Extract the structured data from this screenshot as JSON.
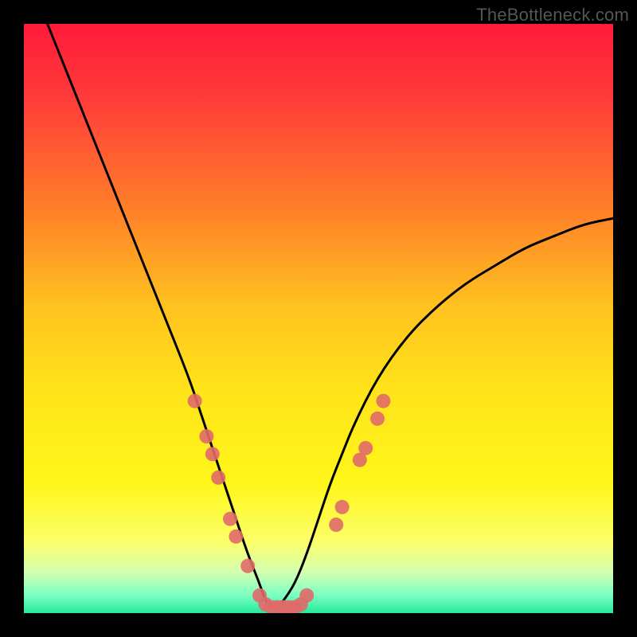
{
  "watermark": "TheBottleneck.com",
  "chart_data": {
    "type": "line",
    "title": "",
    "xlabel": "",
    "ylabel": "",
    "xlim": [
      0,
      100
    ],
    "ylim": [
      0,
      100
    ],
    "series": [
      {
        "name": "bottleneck-curve",
        "x": [
          4,
          8,
          12,
          16,
          20,
          24,
          28,
          30,
          32,
          34,
          36,
          38,
          40,
          41,
          42,
          43,
          44,
          46,
          48,
          50,
          52,
          54,
          56,
          60,
          65,
          70,
          75,
          80,
          85,
          90,
          95,
          100
        ],
        "y": [
          100,
          90,
          80,
          70,
          60,
          50,
          40,
          34,
          28,
          22,
          16,
          10,
          5,
          2,
          1,
          1,
          2,
          5,
          10,
          16,
          22,
          27,
          32,
          40,
          47,
          52,
          56,
          59,
          62,
          64,
          66,
          67
        ]
      }
    ],
    "markers": [
      {
        "x": 29,
        "y": 36
      },
      {
        "x": 31,
        "y": 30
      },
      {
        "x": 32,
        "y": 27
      },
      {
        "x": 33,
        "y": 23
      },
      {
        "x": 35,
        "y": 16
      },
      {
        "x": 36,
        "y": 13
      },
      {
        "x": 38,
        "y": 8
      },
      {
        "x": 40,
        "y": 3
      },
      {
        "x": 41,
        "y": 1.5
      },
      {
        "x": 42,
        "y": 1
      },
      {
        "x": 43,
        "y": 1
      },
      {
        "x": 44,
        "y": 1
      },
      {
        "x": 45,
        "y": 1
      },
      {
        "x": 46,
        "y": 1
      },
      {
        "x": 47,
        "y": 1.5
      },
      {
        "x": 48,
        "y": 3
      },
      {
        "x": 53,
        "y": 15
      },
      {
        "x": 54,
        "y": 18
      },
      {
        "x": 57,
        "y": 26
      },
      {
        "x": 58,
        "y": 28
      },
      {
        "x": 60,
        "y": 33
      },
      {
        "x": 61,
        "y": 36
      }
    ],
    "gradient_stops": [
      {
        "offset": 0.0,
        "color": "#ff1a3a"
      },
      {
        "offset": 0.12,
        "color": "#ff3a3a"
      },
      {
        "offset": 0.3,
        "color": "#ff7a2a"
      },
      {
        "offset": 0.48,
        "color": "#ffc21f"
      },
      {
        "offset": 0.62,
        "color": "#ffe31a"
      },
      {
        "offset": 0.78,
        "color": "#fff61a"
      },
      {
        "offset": 0.88,
        "color": "#fbff6a"
      },
      {
        "offset": 0.93,
        "color": "#d4ffb0"
      },
      {
        "offset": 0.97,
        "color": "#7affc2"
      },
      {
        "offset": 1.0,
        "color": "#26e89a"
      }
    ],
    "marker_color": "#e06a6a",
    "curve_color": "#000000"
  }
}
